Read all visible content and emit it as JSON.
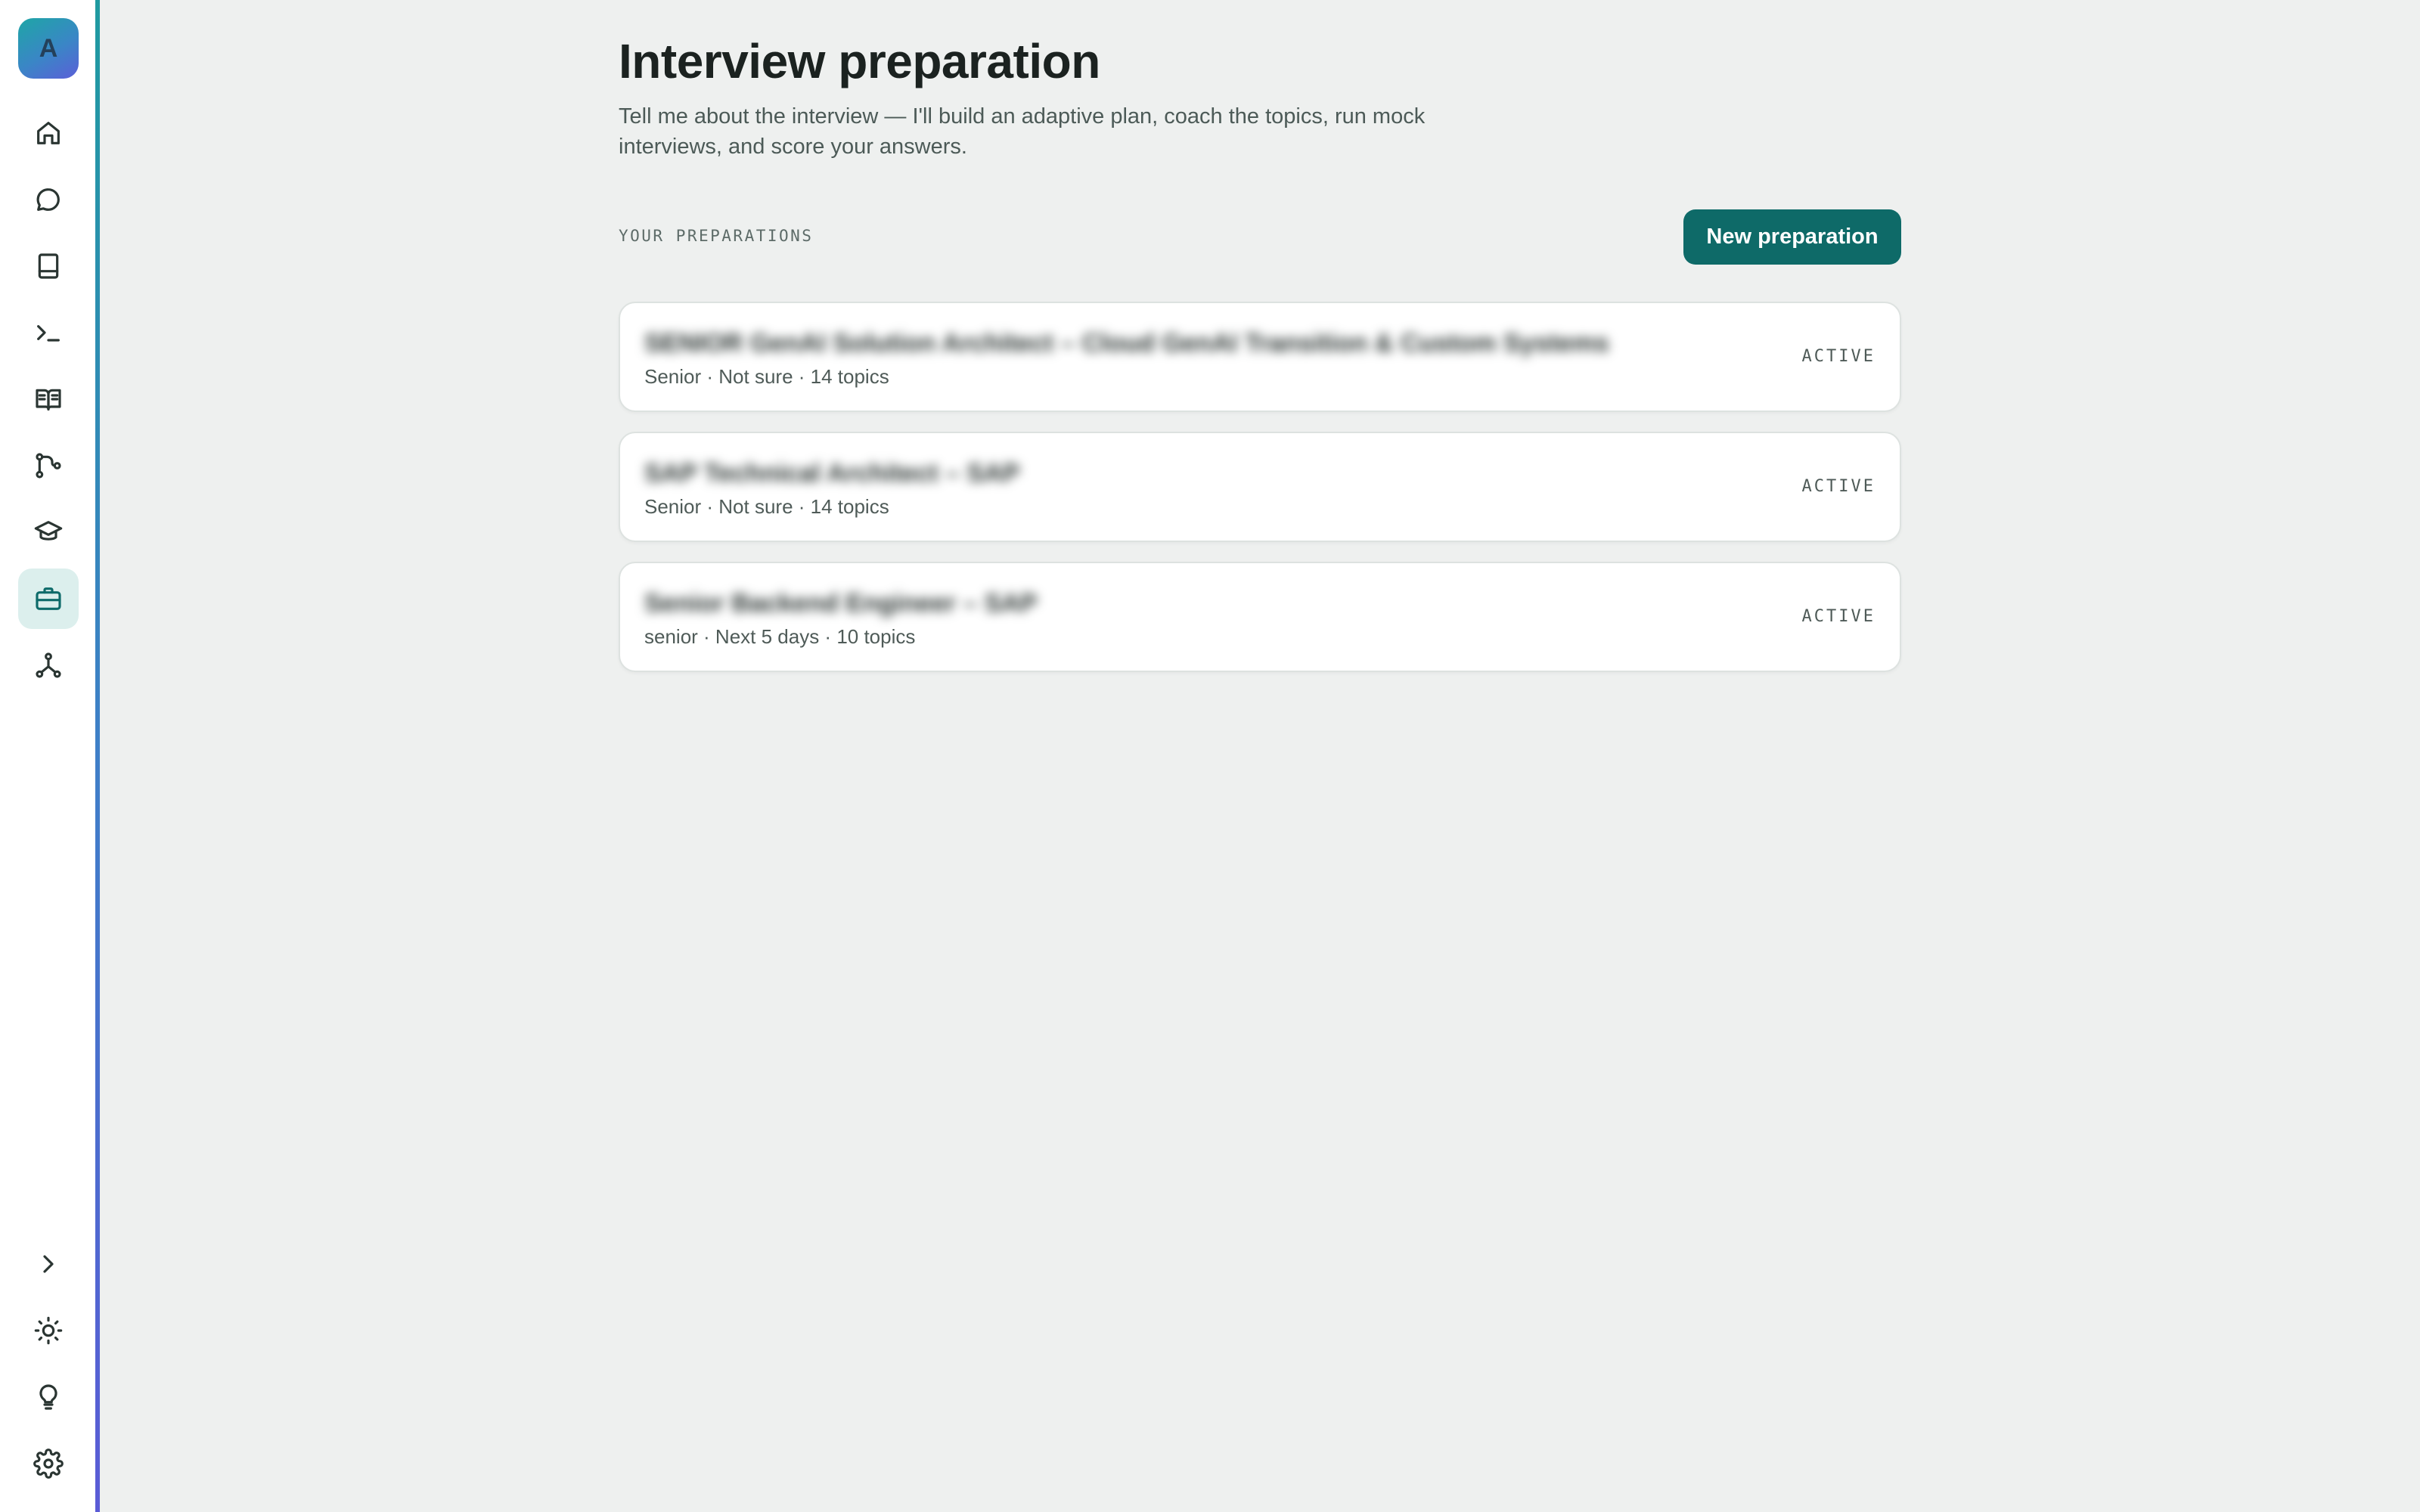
{
  "sidebar": {
    "logo_letter": "A",
    "nav_items": [
      {
        "name": "home",
        "icon": "home-icon"
      },
      {
        "name": "chat",
        "icon": "chat-bubble-icon"
      },
      {
        "name": "notebook",
        "icon": "notebook-icon"
      },
      {
        "name": "terminal",
        "icon": "terminal-icon"
      },
      {
        "name": "reader",
        "icon": "open-book-icon"
      },
      {
        "name": "workflow",
        "icon": "workflow-icon"
      },
      {
        "name": "learn",
        "icon": "graduation-cap-icon"
      },
      {
        "name": "interview",
        "icon": "briefcase-icon",
        "active": true
      },
      {
        "name": "graph",
        "icon": "network-icon"
      }
    ],
    "bottom_items": [
      {
        "name": "expand",
        "icon": "chevron-right-icon"
      },
      {
        "name": "theme",
        "icon": "sun-icon"
      },
      {
        "name": "tips",
        "icon": "lightbulb-icon"
      },
      {
        "name": "settings",
        "icon": "gear-icon"
      }
    ]
  },
  "main": {
    "title": "Interview preparation",
    "subtitle": "Tell me about the interview — I'll build an adaptive plan, coach the topics, run mock interviews, and score your answers.",
    "section_label": "YOUR PREPARATIONS",
    "new_button_label": "New preparation",
    "preparations": [
      {
        "title": "SENIOR GenAI Solution Architect – Cloud GenAI Transition & Custom Systems",
        "meta": "Senior · Not sure · 14 topics",
        "status": "ACTIVE"
      },
      {
        "title": "SAP Technical Architect – SAP",
        "meta": "Senior · Not sure · 14 topics",
        "status": "ACTIVE"
      },
      {
        "title": "Senior Backend Engineer – SAP",
        "meta": "senior · Next 5 days · 10 topics",
        "status": "ACTIVE"
      }
    ]
  },
  "colors": {
    "accent": "#0e6a68",
    "background": "#eef0ef",
    "active_nav_bg": "#dcefed"
  }
}
